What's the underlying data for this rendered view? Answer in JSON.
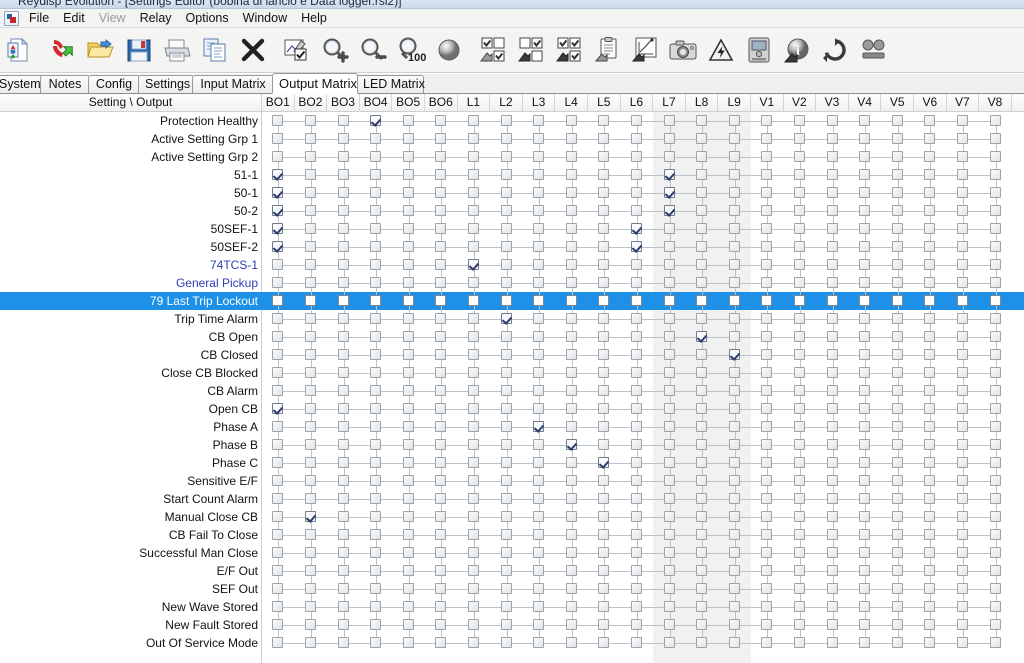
{
  "window": {
    "title": "Reydisp Evolution - [Settings Editor (bobina di lancio e Data logger.rsl2)]"
  },
  "menu": {
    "items": [
      {
        "label": "File",
        "disabled": false
      },
      {
        "label": "Edit",
        "disabled": false
      },
      {
        "label": "View",
        "disabled": true
      },
      {
        "label": "Relay",
        "disabled": false
      },
      {
        "label": "Options",
        "disabled": false
      },
      {
        "label": "Window",
        "disabled": false
      },
      {
        "label": "Help",
        "disabled": false
      }
    ]
  },
  "toolbar": {
    "buttons": [
      {
        "name": "new-file-icon",
        "tip": "New"
      },
      {
        "name": "connect-phone-icon",
        "tip": "Connect"
      },
      {
        "name": "open-folder-icon",
        "tip": "Open"
      },
      {
        "name": "save-floppy-icon",
        "tip": "Save"
      },
      {
        "name": "print-icon",
        "tip": "Print"
      },
      {
        "name": "copy-pages-icon",
        "tip": "Copy"
      },
      {
        "name": "delete-x-icon",
        "tip": "Delete"
      },
      {
        "name": "edit-chart-icon",
        "tip": "Edit"
      },
      {
        "name": "zoom-in-icon",
        "tip": "Zoom In"
      },
      {
        "name": "zoom-out-icon",
        "tip": "Zoom Out"
      },
      {
        "name": "zoom-100-icon",
        "tip": "Zoom 100%"
      },
      {
        "name": "sphere-icon",
        "tip": "Globe"
      },
      {
        "name": "send-checkbox-grid-icon",
        "tip": "Send To Relay"
      },
      {
        "name": "get-checkbox-grid-icon",
        "tip": "Get From Relay"
      },
      {
        "name": "sendall-checkbox-grid-icon",
        "tip": "Send All"
      },
      {
        "name": "clipboard-icon",
        "tip": "Clipboard"
      },
      {
        "name": "graph-export-icon",
        "tip": "Export Graph"
      },
      {
        "name": "camera-icon",
        "tip": "Snapshot"
      },
      {
        "name": "warning-lightning-icon",
        "tip": "Trip"
      },
      {
        "name": "relay-device-icon",
        "tip": "Device"
      },
      {
        "name": "info-icon",
        "tip": "Information"
      },
      {
        "name": "refresh-icon",
        "tip": "Refresh"
      },
      {
        "name": "two-circles-icon",
        "tip": "Compare"
      }
    ]
  },
  "tabs": [
    {
      "label": "System",
      "active": false
    },
    {
      "label": "Notes",
      "active": false
    },
    {
      "label": "Config",
      "active": false
    },
    {
      "label": "Settings",
      "active": false
    },
    {
      "label": "Input Matrix",
      "active": false
    },
    {
      "label": "Output Matrix",
      "active": true
    },
    {
      "label": "LED Matrix",
      "active": false
    }
  ],
  "matrix": {
    "corner_header": "Setting \\ Output",
    "columns": [
      "BO1",
      "BO2",
      "BO3",
      "BO4",
      "BO5",
      "BO6",
      "L1",
      "L2",
      "L3",
      "L4",
      "L5",
      "L6",
      "L7",
      "L8",
      "L9",
      "V1",
      "V2",
      "V3",
      "V4",
      "V5",
      "V6",
      "V7",
      "V8"
    ],
    "banded_columns": [
      "L7",
      "L8",
      "L9"
    ],
    "selected_row": "79 Last Trip Lockout",
    "accent_color": "#1e90e8",
    "link_color": "#2b3fb5",
    "rows": [
      {
        "label": "Protection Healthy",
        "style": "normal",
        "checked": [
          "BO4"
        ]
      },
      {
        "label": "Active Setting Grp 1",
        "style": "normal",
        "checked": []
      },
      {
        "label": "Active Setting Grp 2",
        "style": "normal",
        "checked": []
      },
      {
        "label": "51-1",
        "style": "normal",
        "checked": [
          "BO1",
          "L7"
        ]
      },
      {
        "label": "50-1",
        "style": "normal",
        "checked": [
          "BO1",
          "L7"
        ]
      },
      {
        "label": "50-2",
        "style": "normal",
        "checked": [
          "BO1",
          "L7"
        ]
      },
      {
        "label": "50SEF-1",
        "style": "normal",
        "checked": [
          "BO1",
          "L6"
        ]
      },
      {
        "label": "50SEF-2",
        "style": "normal",
        "checked": [
          "BO1",
          "L6"
        ]
      },
      {
        "label": "74TCS-1",
        "style": "blue",
        "checked": [
          "L1"
        ]
      },
      {
        "label": "General Pickup",
        "style": "blue",
        "checked": []
      },
      {
        "label": "79 Last Trip Lockout",
        "style": "selected",
        "checked": []
      },
      {
        "label": "Trip Time Alarm",
        "style": "normal",
        "checked": [
          "L2"
        ]
      },
      {
        "label": "CB Open",
        "style": "normal",
        "checked": [
          "L8"
        ]
      },
      {
        "label": "CB Closed",
        "style": "normal",
        "checked": [
          "L9"
        ]
      },
      {
        "label": "Close CB Blocked",
        "style": "normal",
        "checked": []
      },
      {
        "label": "CB Alarm",
        "style": "normal",
        "checked": []
      },
      {
        "label": "Open CB",
        "style": "normal",
        "checked": [
          "BO1"
        ]
      },
      {
        "label": "Phase A",
        "style": "normal",
        "checked": [
          "L3"
        ]
      },
      {
        "label": "Phase B",
        "style": "normal",
        "checked": [
          "L4"
        ]
      },
      {
        "label": "Phase C",
        "style": "normal",
        "checked": [
          "L5"
        ]
      },
      {
        "label": "Sensitive E/F",
        "style": "normal",
        "checked": []
      },
      {
        "label": "Start Count Alarm",
        "style": "normal",
        "checked": []
      },
      {
        "label": "Manual Close CB",
        "style": "normal",
        "checked": [
          "BO2"
        ]
      },
      {
        "label": "CB Fail To Close",
        "style": "normal",
        "checked": []
      },
      {
        "label": "Successful Man Close",
        "style": "normal",
        "checked": []
      },
      {
        "label": "E/F Out",
        "style": "normal",
        "checked": []
      },
      {
        "label": "SEF Out",
        "style": "normal",
        "checked": []
      },
      {
        "label": "New Wave Stored",
        "style": "normal",
        "checked": []
      },
      {
        "label": "New Fault Stored",
        "style": "normal",
        "checked": []
      },
      {
        "label": "Out Of Service Mode",
        "style": "normal",
        "checked": []
      }
    ]
  }
}
